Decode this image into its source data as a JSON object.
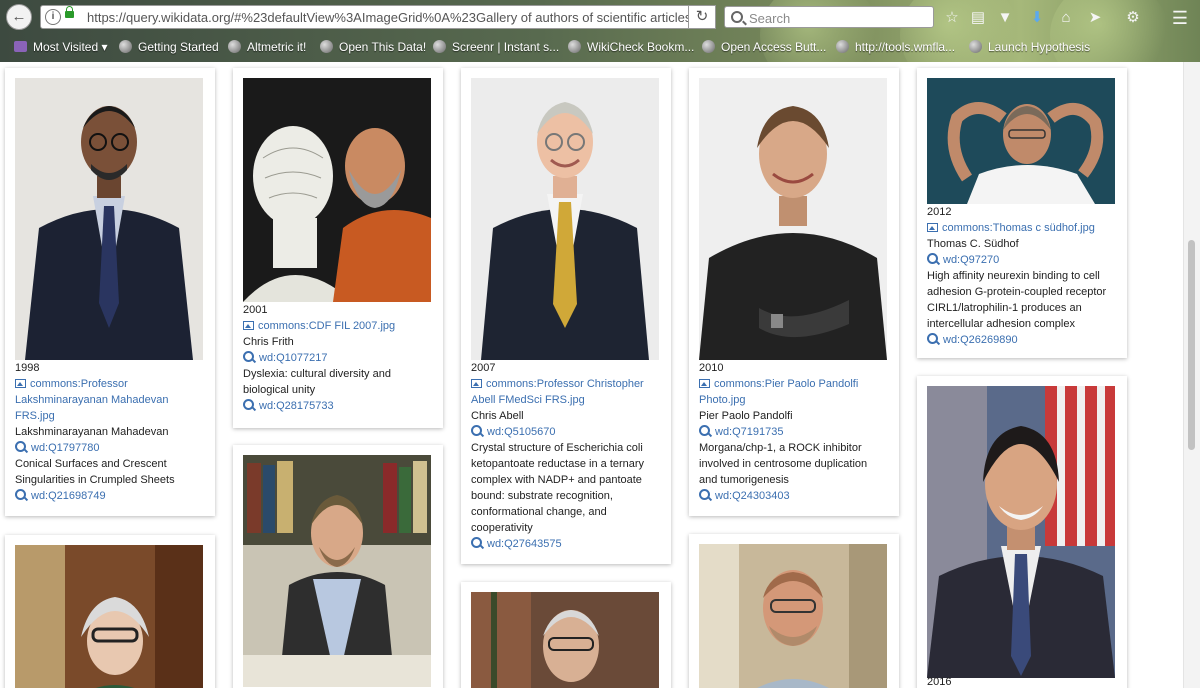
{
  "browser": {
    "url": "https://query.wikidata.org/#%23defaultView%3AImageGrid%0A%23Gallery of authors of scientific articles th",
    "search_placeholder": "Search",
    "bookmarks": [
      "Most Visited",
      "Getting Started",
      "Altmetric it!",
      "Open This Data!",
      "Screenr | Instant s...",
      "WikiCheck Bookm...",
      "Open Access Butt...",
      "http://tools.wmfla...",
      "Launch Hypothesis"
    ],
    "toolbar_icons": [
      "star-icon",
      "reading-list-icon",
      "pocket-icon",
      "download-icon",
      "home-icon",
      "send-icon",
      "extension-icon",
      "menu-icon"
    ]
  },
  "gallery": [
    {
      "year": "1998",
      "image": "commons:Professor Lakshminarayanan Mahadevan FRS.jpg",
      "image_lines": [
        "commons:Professor",
        "Lakshminarayanan Mahadevan",
        "FRS.jpg"
      ],
      "author": "Lakshminarayanan Mahadevan",
      "author_qid": "wd:Q1797780",
      "article_lines": [
        "Conical Surfaces and Crescent",
        "Singularities in Crumpled Sheets"
      ],
      "article_qid": "wd:Q21698749"
    },
    {
      "year": "2001",
      "image": "commons:CDF FIL 2007.jpg",
      "image_lines": [
        "commons:CDF FIL 2007.jpg"
      ],
      "author": "Chris Frith",
      "author_qid": "wd:Q1077217",
      "article_lines": [
        "Dyslexia: cultural diversity and",
        "biological unity"
      ],
      "article_qid": "wd:Q28175733"
    },
    {
      "year": "2007",
      "image": "commons:Professor Christopher Abell FMedSci FRS.jpg",
      "image_lines": [
        "commons:Professor Christopher",
        "Abell FMedSci FRS.jpg"
      ],
      "author": "Chris Abell",
      "author_qid": "wd:Q5105670",
      "article_lines": [
        "Crystal structure of Escherichia coli",
        "ketopantoate reductase in a ternary",
        "complex with NADP+ and pantoate",
        "bound: substrate recognition,",
        "conformational change, and",
        "cooperativity"
      ],
      "article_qid": "wd:Q27643575"
    },
    {
      "year": "2010",
      "image": "commons:Pier Paolo Pandolfi Photo.jpg",
      "image_lines": [
        "commons:Pier Paolo Pandolfi",
        "Photo.jpg"
      ],
      "author": "Pier Paolo Pandolfi",
      "author_qid": "wd:Q7191735",
      "article_lines": [
        "Morgana/chp-1, a ROCK inhibitor",
        "involved in centrosome duplication",
        "and tumorigenesis"
      ],
      "article_qid": "wd:Q24303403"
    },
    {
      "year": "2012",
      "image": "commons:Thomas c südhof.jpg",
      "image_lines": [
        "commons:Thomas c südhof.jpg"
      ],
      "author": "Thomas C. Südhof",
      "author_qid": "wd:Q97270",
      "article_lines": [
        "High affinity neurexin binding to cell",
        "adhesion G-protein-coupled receptor",
        "CIRL1/latrophilin-1 produces an",
        "intercellular adhesion complex"
      ],
      "article_qid": "wd:Q26269890"
    },
    {
      "year": "2016"
    }
  ]
}
